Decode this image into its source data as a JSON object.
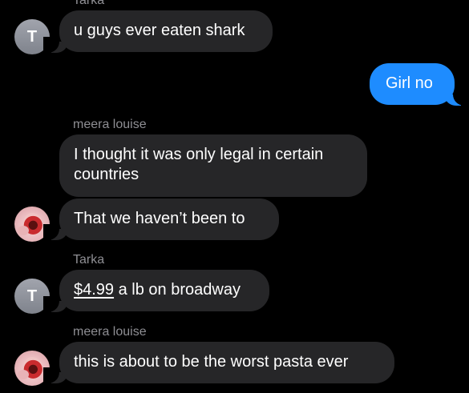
{
  "thread": {
    "messages": [
      {
        "sender": "Tarka",
        "avatar_letter": "T",
        "text": "u guys ever eaten shark",
        "direction": "incoming"
      },
      {
        "sender": "",
        "text": "Girl no",
        "direction": "outgoing"
      },
      {
        "sender": "meera louise",
        "text": "I thought it was only legal in certain countries",
        "direction": "incoming"
      },
      {
        "sender": "",
        "text": "That we haven’t been to",
        "direction": "incoming",
        "avatar": "photo"
      },
      {
        "sender": "Tarka",
        "avatar_letter": "T",
        "link_text": "$4.99",
        "text_after": " a lb on broadway",
        "direction": "incoming"
      },
      {
        "sender": "meera louise",
        "text": "this is about to be the worst pasta ever",
        "direction": "incoming",
        "avatar": "photo"
      }
    ]
  },
  "colors": {
    "background": "#000000",
    "incoming_bubble": "#262628",
    "outgoing_bubble": "#1e8cff",
    "sender_name": "#8e8e93"
  }
}
